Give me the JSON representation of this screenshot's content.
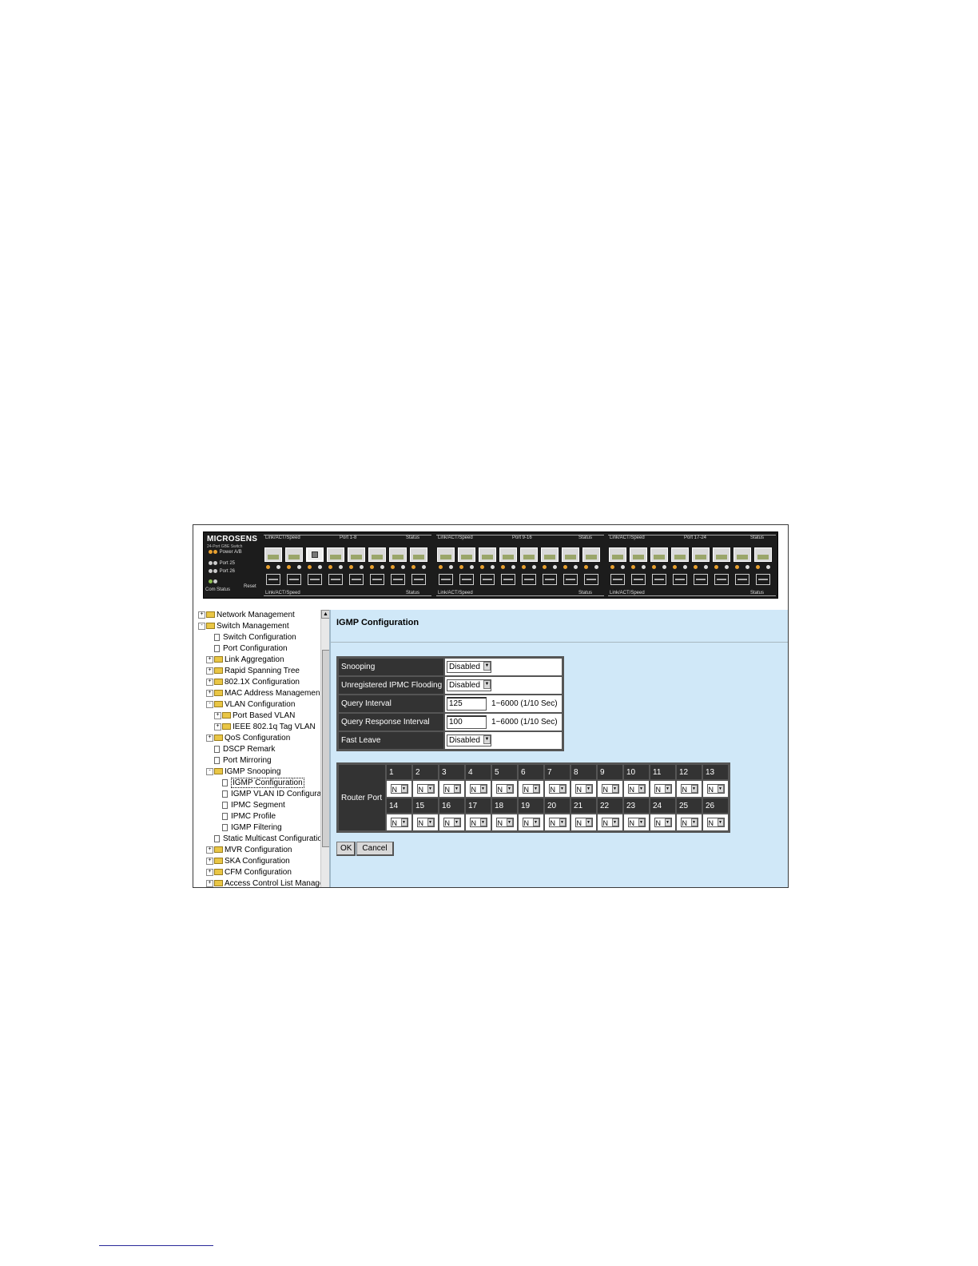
{
  "device": {
    "brand": "MICROSENS",
    "model": "24-Port GBE Switch",
    "legend": {
      "power": "Power A/B",
      "port25": "Port 25",
      "port26": "Port 26",
      "com": "Com",
      "status": "Status",
      "reset": "Reset"
    },
    "groups": [
      {
        "top_left": "Link/ACT/Speed",
        "title": "Port 1-8",
        "top_right": "Status",
        "bottom_left": "Link/ACT/Speed",
        "bottom_right": "Status"
      },
      {
        "top_left": "Link/ACT/Speed",
        "title": "Port 9-16",
        "top_right": "Status",
        "bottom_left": "Link/ACT/Speed",
        "bottom_right": "Status"
      },
      {
        "top_left": "Link/ACT/Speed",
        "title": "Port 17-24",
        "top_right": "Status",
        "bottom_left": "Link/ACT/Speed",
        "bottom_right": "Status"
      }
    ]
  },
  "sidebar": {
    "items": [
      "Network Management",
      "Switch Management",
      "Switch Configuration",
      "Port Configuration",
      "Link Aggregation",
      "Rapid Spanning Tree",
      "802.1X Configuration",
      "MAC Address Managemen",
      "VLAN Configuration",
      "Port Based VLAN",
      "IEEE 802.1q Tag VLAN",
      "QoS Configuration",
      "DSCP Remark",
      "Port Mirroring",
      "IGMP Snooping",
      "IGMP Configuration",
      "IGMP VLAN ID Configura",
      "IPMC Segment",
      "IPMC Profile",
      "IGMP Filtering",
      "Static Multicast Configuratio",
      "MVR Configuration",
      "SKA Configuration",
      "CFM Configuration",
      "Access Control List Manage"
    ]
  },
  "main": {
    "title": "IGMP Configuration",
    "settings": {
      "snooping_label": "Snooping",
      "snooping_value": "Disabled",
      "flooding_label": "Unregistered IPMC Flooding",
      "flooding_value": "Disabled",
      "query_interval_label": "Query Interval",
      "query_interval_value": "125",
      "query_interval_hint": "1~6000 (1/10 Sec)",
      "query_response_label": "Query Response Interval",
      "query_response_value": "100",
      "query_response_hint": "1~6000 (1/10 Sec)",
      "fast_leave_label": "Fast Leave",
      "fast_leave_value": "Disabled"
    },
    "router_port": {
      "label": "Router Port",
      "row1": [
        "1",
        "2",
        "3",
        "4",
        "5",
        "6",
        "7",
        "8",
        "9",
        "10",
        "11",
        "12",
        "13"
      ],
      "row2": [
        "14",
        "15",
        "16",
        "17",
        "18",
        "19",
        "20",
        "21",
        "22",
        "23",
        "24",
        "25",
        "26"
      ],
      "value": "N"
    },
    "ok_label": "OK",
    "cancel_label": "Cancel"
  }
}
